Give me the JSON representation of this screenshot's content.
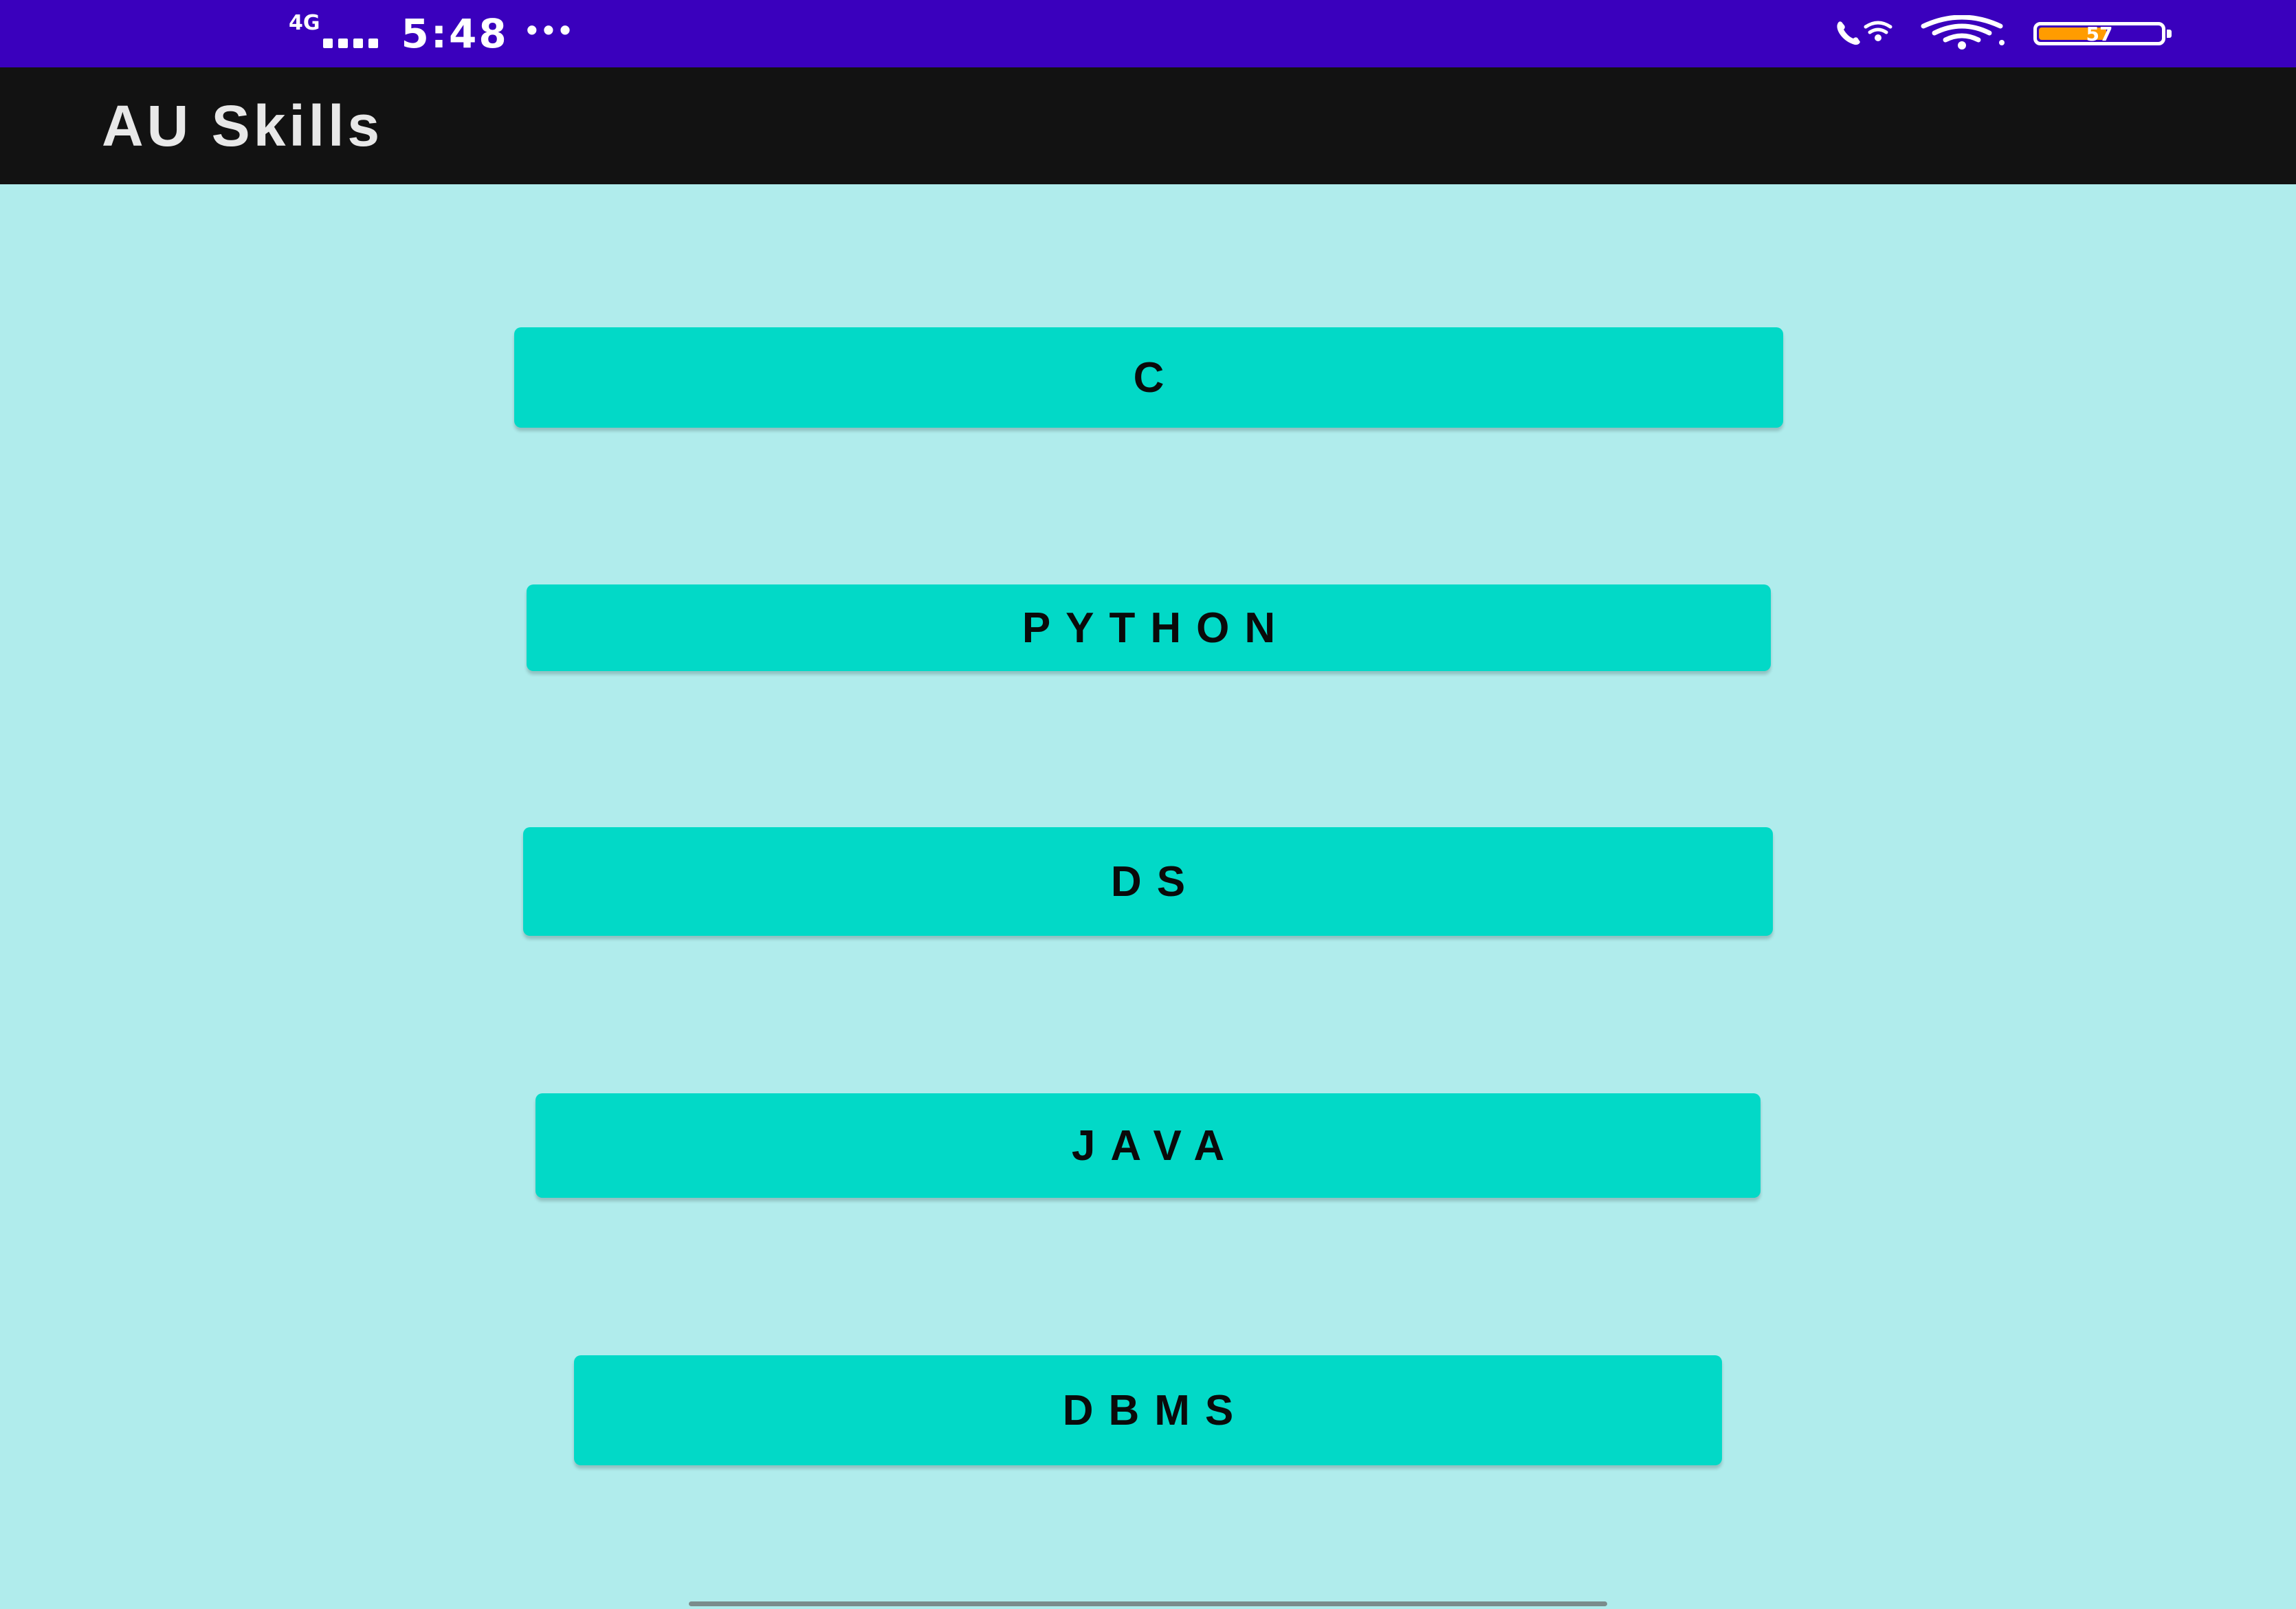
{
  "status_bar": {
    "network_type": "4G",
    "time": "5:48",
    "overflow_indicator": "•••",
    "battery_level": "57",
    "battery_fraction": 0.57,
    "background_color": "#3a00bd",
    "icons": [
      "signal-bars-icon",
      "wifi-calling-icon",
      "wifi-icon",
      "battery-icon"
    ]
  },
  "app_bar": {
    "title": "AU Skills",
    "background_color": "#121212"
  },
  "main": {
    "background_color": "#b0ecec",
    "button_color": "#02d9c7",
    "buttons": [
      {
        "label": "C"
      },
      {
        "label": "PYTHON"
      },
      {
        "label": "DS"
      },
      {
        "label": "JAVA"
      },
      {
        "label": "DBMS"
      }
    ]
  }
}
